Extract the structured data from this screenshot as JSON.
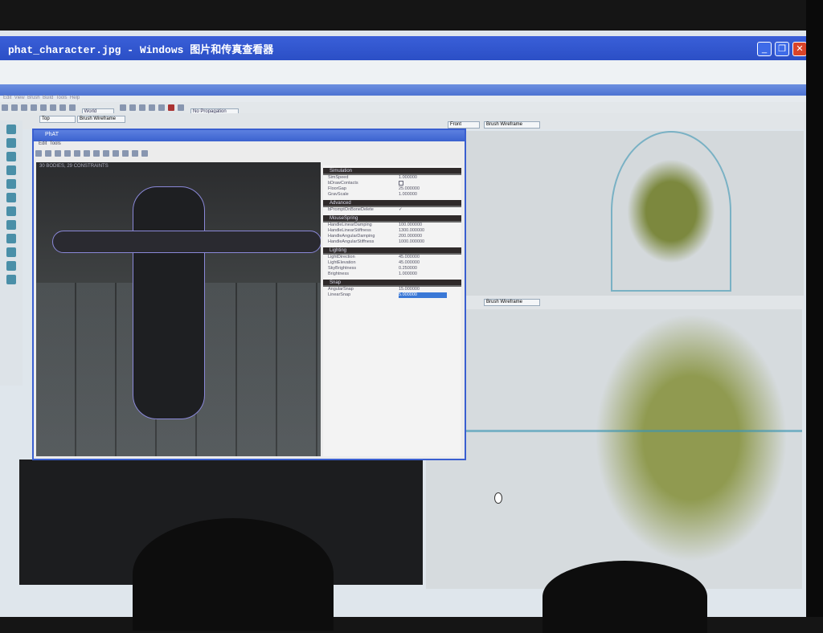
{
  "window": {
    "title": "phat_character.jpg - Windows 图片和传真查看器",
    "buttons": [
      "minimize",
      "restore",
      "close"
    ]
  },
  "editor": {
    "menu": [
      "Edit",
      "View",
      "Brush",
      "Build",
      "Tools",
      "Help"
    ],
    "toolbar": {
      "coord_system": "World",
      "propagation": "No Propagation"
    },
    "viewport_top_left": {
      "view": "Top",
      "mode": "Brush Wireframe"
    },
    "viewport_top_right": {
      "view": "Front",
      "mode": "Brush Wireframe"
    },
    "viewport_bottom_right": {
      "mode": "Brush Wireframe"
    }
  },
  "phat": {
    "title": "PhAT",
    "menu": [
      "Edit",
      "Tools"
    ],
    "status": "30 BODIES, 29 CONSTRAINTS",
    "sections": [
      {
        "name": "Simulation",
        "rows": [
          [
            "SimSpeed",
            "1.000000"
          ],
          [
            "bDrawContacts",
            ""
          ],
          [
            "FloorGap",
            "25.000000"
          ],
          [
            "GravScale",
            "1.000000"
          ]
        ]
      },
      {
        "name": "Advanced",
        "rows": [
          [
            "bPromptOnBoneDelete",
            "✓"
          ]
        ]
      },
      {
        "name": "MouseSpring",
        "rows": [
          [
            "HandleLinearDamping",
            "100.000000"
          ],
          [
            "HandleLinearStiffness",
            "1300.000000"
          ],
          [
            "HandleAngularDamping",
            "200.000000"
          ],
          [
            "HandleAngularStiffness",
            "1000.000000"
          ]
        ]
      },
      {
        "name": "Lighting",
        "rows": [
          [
            "LightDirection",
            "45.000000"
          ],
          [
            "LightElevation",
            "45.000000"
          ],
          [
            "SkyBrightness",
            "0.250000"
          ],
          [
            "Brightness",
            "1.000000"
          ]
        ]
      },
      {
        "name": "Snap",
        "rows": [
          [
            "AngularSnap",
            "15.000000"
          ],
          [
            "LinearSnap",
            "5.000000"
          ]
        ]
      }
    ]
  },
  "colors": {
    "titlebar": "#2b4fc6",
    "wireframe": "#4a9fb8",
    "mesh": "#7a8a2a"
  }
}
